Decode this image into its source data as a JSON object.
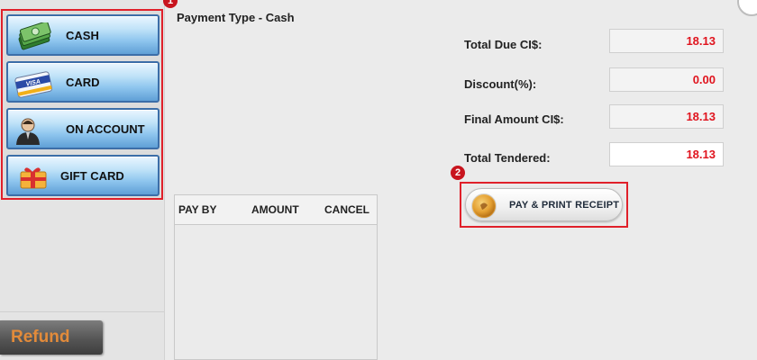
{
  "payment_methods": [
    {
      "id": "cash",
      "label": "CASH",
      "icon": "cash-icon"
    },
    {
      "id": "card",
      "label": "CARD",
      "icon": "credit-card-icon"
    },
    {
      "id": "on_account",
      "label": "ON ACCOUNT",
      "icon": "person-icon"
    },
    {
      "id": "gift_card",
      "label": "GIFT CARD",
      "icon": "gift-card-icon"
    }
  ],
  "card_icon_text": "VISA",
  "refund_label": "Refund",
  "badges": {
    "first": "1",
    "second": "2"
  },
  "payment_type": "Payment Type - Cash",
  "table_headers": [
    "PAY BY",
    "AMOUNT",
    "CANCEL"
  ],
  "summary": {
    "total_due_label": "Total Due CI$:",
    "total_due_value": "18.13",
    "discount_label": "Discount(%):",
    "discount_value": "0.00",
    "final_amount_label": "Final Amount CI$:",
    "final_amount_value": "18.13",
    "total_tendered_label": "Total Tendered:",
    "total_tendered_value": "18.13"
  },
  "pay_print_label": "PAY & PRINT RECEIPT",
  "colors": {
    "highlight_border": "#e0202a",
    "value_text": "#e0141e",
    "refund_text": "#e38b3a",
    "method_button_blue": "#8ec5ee"
  }
}
